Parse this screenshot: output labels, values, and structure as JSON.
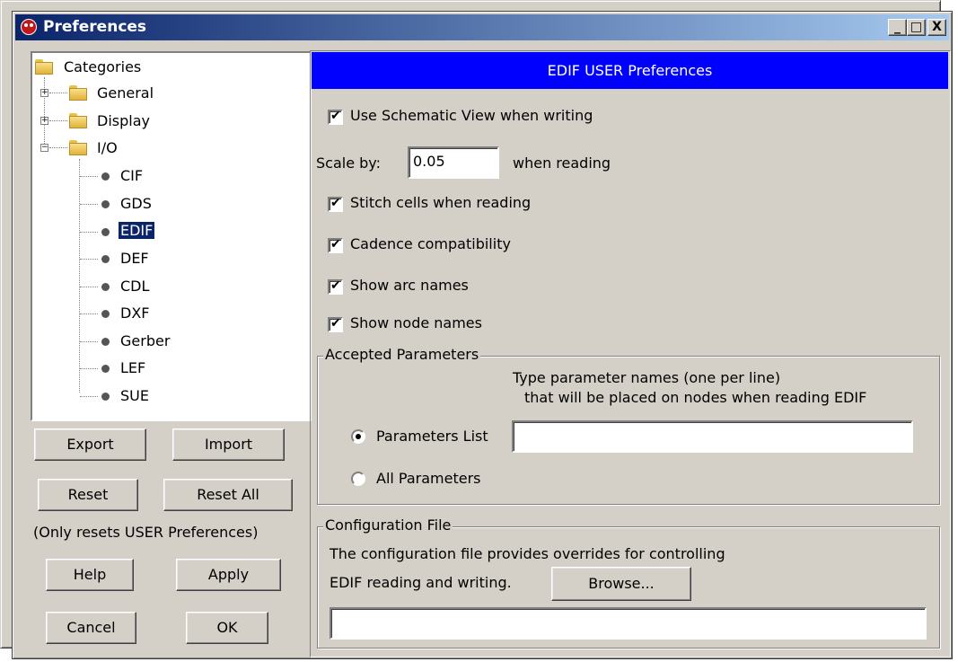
{
  "window": {
    "title": "Preferences",
    "buttons": {
      "minimize": "_",
      "maximize": "□",
      "close": "X"
    }
  },
  "tree": {
    "root": "Categories",
    "groups": [
      {
        "label": "General",
        "expanded": false
      },
      {
        "label": "Display",
        "expanded": false
      },
      {
        "label": "I/O",
        "expanded": true
      }
    ],
    "io_children": [
      "CIF",
      "GDS",
      "EDIF",
      "DEF",
      "CDL",
      "DXF",
      "Gerber",
      "LEF",
      "SUE"
    ],
    "selected": "EDIF"
  },
  "left_buttons": {
    "export": "Export",
    "import": "Import",
    "reset": "Reset",
    "reset_all": "Reset All",
    "reset_note": "(Only resets USER Preferences)",
    "help": "Help",
    "apply": "Apply",
    "cancel": "Cancel",
    "ok": "OK"
  },
  "panel": {
    "header": "EDIF USER Preferences",
    "use_schematic": {
      "label": "Use Schematic View when writing",
      "checked": true
    },
    "scale": {
      "prefix": "Scale by:",
      "value": "0.05",
      "suffix": "when reading"
    },
    "stitch_cells": {
      "label": "Stitch cells when reading",
      "checked": true
    },
    "cadence": {
      "label": "Cadence compatibility",
      "checked": true
    },
    "show_arc": {
      "label": "Show arc names",
      "checked": true
    },
    "show_node": {
      "label": "Show node names",
      "checked": true
    },
    "accepted_params": {
      "title": "Accepted Parameters",
      "desc_line1": "Type parameter names (one per line)",
      "desc_line2": "that will be placed on nodes when reading EDIF",
      "params_list": {
        "label": "Parameters List",
        "selected": true,
        "value": ""
      },
      "all_params": {
        "label": "All Parameters",
        "selected": false
      }
    },
    "config_file": {
      "title": "Configuration File",
      "desc_line1": "The configuration file provides overrides for controlling",
      "desc_line2": "EDIF reading and writing.",
      "browse": "Browse...",
      "path": ""
    }
  },
  "colors": {
    "header_bg": "#0000ff",
    "selection_bg": "#0a246a",
    "face": "#d4d0c8"
  }
}
